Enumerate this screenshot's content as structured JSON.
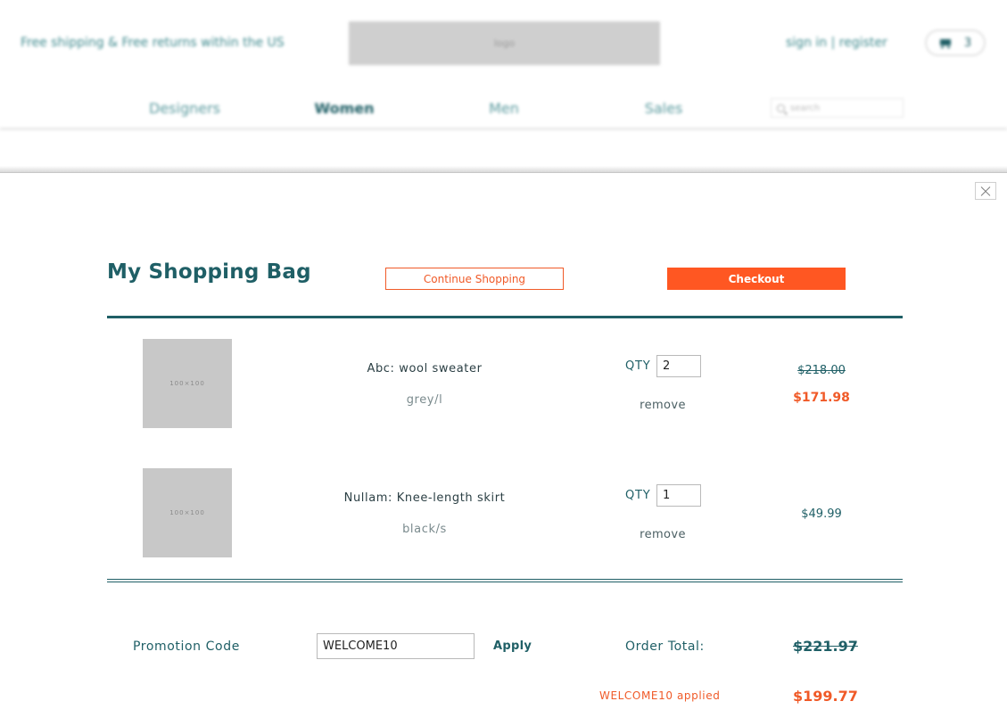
{
  "site_header": {
    "shipping_notice": "Free shipping & Free returns within the US",
    "logo_text": "logo",
    "account_links": "sign in | register",
    "cart_count": "3",
    "nav": [
      "Designers",
      "Women",
      "Men",
      "Sales"
    ],
    "active_nav": "Women",
    "search_placeholder": "search"
  },
  "bag": {
    "title": "My Shopping Bag",
    "continue_label": "Continue Shopping",
    "checkout_label": "Checkout",
    "items": [
      {
        "thumb_label": "100×100",
        "name": "Abc: wool sweater",
        "variant": "grey/l",
        "qty_label": "QTY",
        "qty": "2",
        "remove_label": "remove",
        "price_original": "$218.00",
        "price_sale": "$171.98"
      },
      {
        "thumb_label": "100×100",
        "name": "Nullam: Knee-length skirt",
        "variant": "black/s",
        "qty_label": "QTY",
        "qty": "1",
        "remove_label": "remove",
        "price": "$49.99"
      }
    ],
    "promo": {
      "label": "Promotion Code",
      "value": "WELCOME10",
      "apply_label": "Apply",
      "applied_message": "WELCOME10 applied"
    },
    "total": {
      "label": "Order Total:",
      "original": "$221.97",
      "final": "$199.77"
    }
  },
  "colors": {
    "brand_teal": "#1f5f66",
    "accent_orange": "#ff5722",
    "placeholder_gray": "#c8c8c8"
  }
}
